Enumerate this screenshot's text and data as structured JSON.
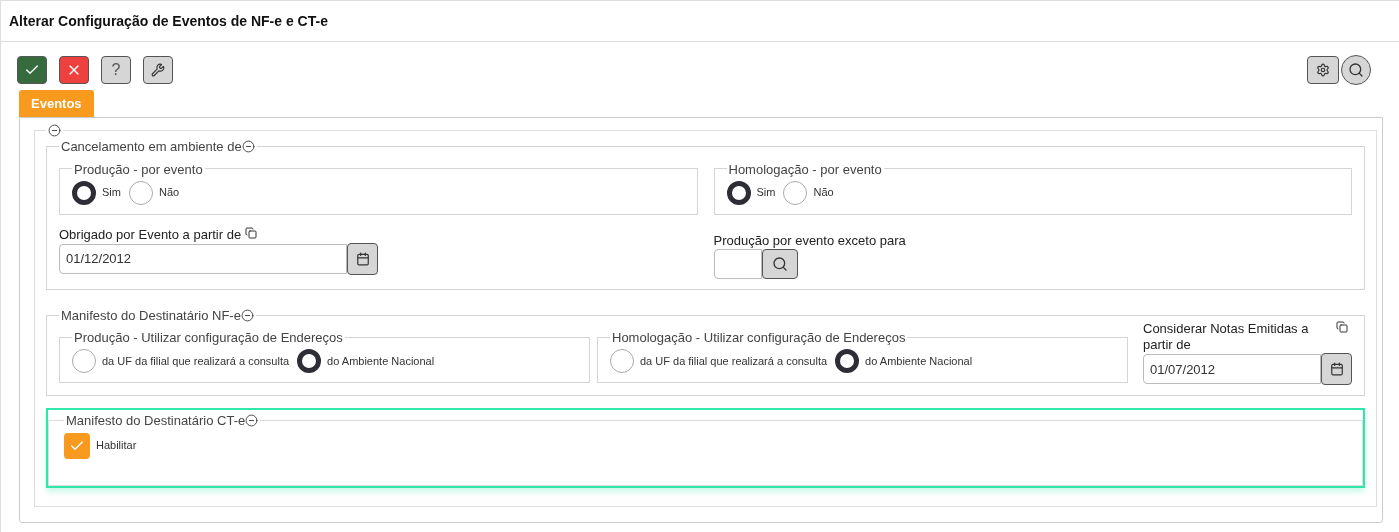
{
  "window": {
    "title": "Alterar Configuração de Eventos de NF-e e CT-e"
  },
  "toolbar": {
    "buttons": [
      {
        "kind": "confirm"
      },
      {
        "kind": "cancel"
      },
      {
        "kind": "help",
        "label": "?"
      },
      {
        "kind": "tools"
      }
    ],
    "right_buttons": [
      {
        "kind": "settings"
      },
      {
        "kind": "search"
      }
    ]
  },
  "tabs": [
    {
      "label": "Eventos",
      "selected": true
    }
  ],
  "cancelamento": {
    "title": "Cancelamento em ambiente de",
    "radio_groups": [
      {
        "title": "Produção - por evento",
        "options": [
          {
            "label": "Sim",
            "selected": true
          },
          {
            "label": "Não",
            "selected": false
          }
        ]
      },
      {
        "title": "Homologação - por evento",
        "options": [
          {
            "label": "Sim",
            "selected": true
          },
          {
            "label": "Não",
            "selected": false
          }
        ]
      }
    ],
    "date_field": {
      "label": "Obrigado por Evento a partir de",
      "value": "01/12/2012"
    },
    "lookup_field": {
      "label": "Produção por evento exceto para"
    }
  },
  "manifesto_nfe": {
    "title": "Manifesto do Destinatário NF-e",
    "radio_groups": [
      {
        "title": "Produção - Utilizar configuração de Endereços",
        "options": [
          {
            "label": "da UF da filial que realizará a consulta",
            "selected": false
          },
          {
            "label": "do Ambiente Nacional",
            "selected": true
          }
        ]
      },
      {
        "title": "Homologação - Utilizar configuração de Endereços",
        "options": [
          {
            "label": "da UF da filial que realizará a consulta",
            "selected": false
          },
          {
            "label": "do Ambiente Nacional",
            "selected": true
          }
        ]
      }
    ],
    "date_field": {
      "label": "Considerar Notas Emitidas a partir de",
      "value": "01/07/2012"
    }
  },
  "manifesto_cte": {
    "title": "Manifesto do Destinatário CT-e",
    "focused": true,
    "checkbox": {
      "label": "Habilitar",
      "checked": true
    }
  }
}
